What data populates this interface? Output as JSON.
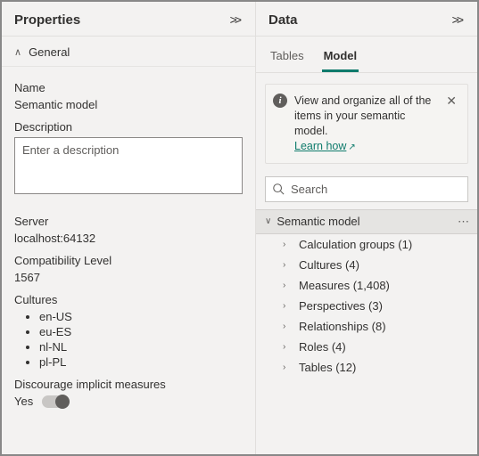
{
  "properties": {
    "title": "Properties",
    "general_label": "General",
    "name_label": "Name",
    "name_value": "Semantic model",
    "description_label": "Description",
    "description_placeholder": "Enter a description",
    "server_label": "Server",
    "server_value": "localhost:64132",
    "compat_label": "Compatibility Level",
    "compat_value": "1567",
    "cultures_label": "Cultures",
    "cultures": [
      "en-US",
      "eu-ES",
      "nl-NL",
      "pl-PL"
    ],
    "discourage_label": "Discourage implicit measures",
    "discourage_value": "Yes"
  },
  "data": {
    "title": "Data",
    "tabs": {
      "tables": "Tables",
      "model": "Model"
    },
    "info": {
      "text": "View and organize all of the items in your semantic model.",
      "link": "Learn how"
    },
    "search_placeholder": "Search",
    "root": "Semantic model",
    "items": [
      {
        "label": "Calculation groups",
        "count": 1
      },
      {
        "label": "Cultures",
        "count": 4
      },
      {
        "label": "Measures",
        "count": 1408
      },
      {
        "label": "Perspectives",
        "count": 3
      },
      {
        "label": "Relationships",
        "count": 8
      },
      {
        "label": "Roles",
        "count": 4
      },
      {
        "label": "Tables",
        "count": 12
      }
    ]
  }
}
